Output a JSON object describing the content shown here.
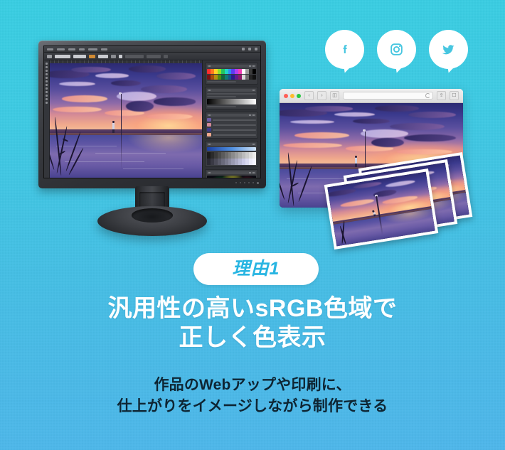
{
  "theme": {
    "bg_top": "#3ACDE1",
    "bg_bottom": "#4FB6E9",
    "accent_cyan": "#28B5E2",
    "badge_bg": "#FFFFFF",
    "headline_color": "#FFFFFF",
    "subline_color": "#0E2533"
  },
  "social": {
    "items": [
      {
        "name": "facebook",
        "icon": "facebook-icon",
        "glyph": "f"
      },
      {
        "name": "instagram",
        "icon": "instagram-icon",
        "glyph": "▢"
      },
      {
        "name": "twitter",
        "icon": "twitter-icon",
        "glyph": "ᴠ"
      }
    ]
  },
  "monitor": {
    "icon": "monitor-icon",
    "app": {
      "name": "photo-editing-app",
      "panels": [
        {
          "name": "color-swatches-panel"
        },
        {
          "name": "gradient-panel"
        },
        {
          "name": "layers-panel"
        },
        {
          "name": "swatch-grid-panel"
        },
        {
          "name": "color-gamut-panel"
        }
      ]
    },
    "artwork": {
      "name": "sunset-lake-illustration",
      "description": "夕暮れの湖と人物"
    }
  },
  "browser": {
    "icon": "browser-window-icon",
    "traffic_lights": [
      "#FF5F57",
      "#FEBC2E",
      "#28C840"
    ],
    "url_value": "",
    "url_placeholder": ""
  },
  "prints": {
    "name": "photo-prints-stack",
    "count": 3
  },
  "badge": {
    "label": "理由1"
  },
  "headline": {
    "line1": "汎用性の高いsRGB色域で",
    "line2": "正しく色表示"
  },
  "subline": {
    "line1": "作品のWebアップや印刷に、",
    "line2": "仕上がりをイメージしながら制作できる"
  }
}
